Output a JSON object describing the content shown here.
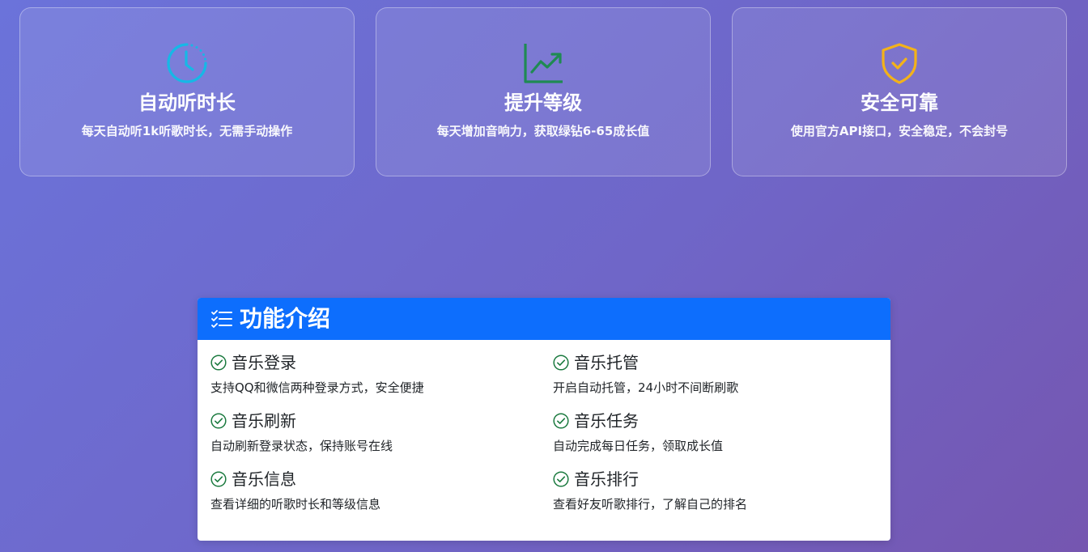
{
  "feature_cards": [
    {
      "icon": "clock-icon",
      "icon_color": "#16b8e6",
      "title": "自动听时长",
      "description": "每天自动听1k听歌时长，无需手动操作"
    },
    {
      "icon": "trending-up-icon",
      "icon_color": "#1f8a53",
      "title": "提升等级",
      "description": "每天增加音响力，获取绿钻6-65成长值"
    },
    {
      "icon": "shield-check-icon",
      "icon_color": "#f3b21a",
      "title": "安全可靠",
      "description": "使用官方API接口，安全稳定，不会封号"
    }
  ],
  "panel": {
    "header_icon": "list-check-icon",
    "title": "功能介绍",
    "header_color": "#0d6efd",
    "check_color": "#1b7a3f",
    "items": [
      {
        "title": "音乐登录",
        "description": "支持QQ和微信两种登录方式，安全便捷"
      },
      {
        "title": "音乐托管",
        "description": "开启自动托管，24小时不间断刷歌"
      },
      {
        "title": "音乐刷新",
        "description": "自动刷新登录状态，保持账号在线"
      },
      {
        "title": "音乐任务",
        "description": "自动完成每日任务，领取成长值"
      },
      {
        "title": "音乐信息",
        "description": "查看详细的听歌时长和等级信息"
      },
      {
        "title": "音乐排行",
        "description": "查看好友听歌排行，了解自己的排名"
      }
    ]
  }
}
